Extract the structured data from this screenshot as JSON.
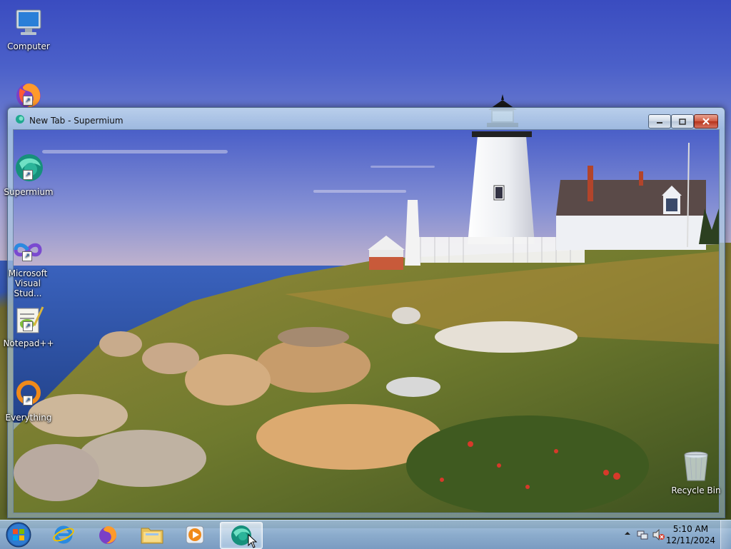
{
  "desktop": {
    "icons": [
      {
        "label": "Computer"
      },
      {
        "label": ""
      },
      {
        "label": "Supermium"
      },
      {
        "label": "Microsoft Visual Stud..."
      },
      {
        "label": "Notepad++"
      },
      {
        "label": "Everything"
      },
      {
        "label": "Recycle Bin"
      }
    ]
  },
  "window": {
    "title": "New Tab - Supermium",
    "controls": {
      "minimize": "minimize",
      "maximize": "maximize",
      "close": "close"
    }
  },
  "taskbar": {
    "pinned": [
      {
        "name": "Internet Explorer"
      },
      {
        "name": "Firefox"
      },
      {
        "name": "Windows Explorer"
      },
      {
        "name": "Windows Media Player"
      },
      {
        "name": "Supermium"
      }
    ],
    "clock": {
      "time": "5:10 AM",
      "date": "12/11/2024"
    }
  },
  "colors": {
    "taskbar": "#8aaed0",
    "close_button": "#c8452c",
    "supermium_teal": "#1fa88f"
  }
}
